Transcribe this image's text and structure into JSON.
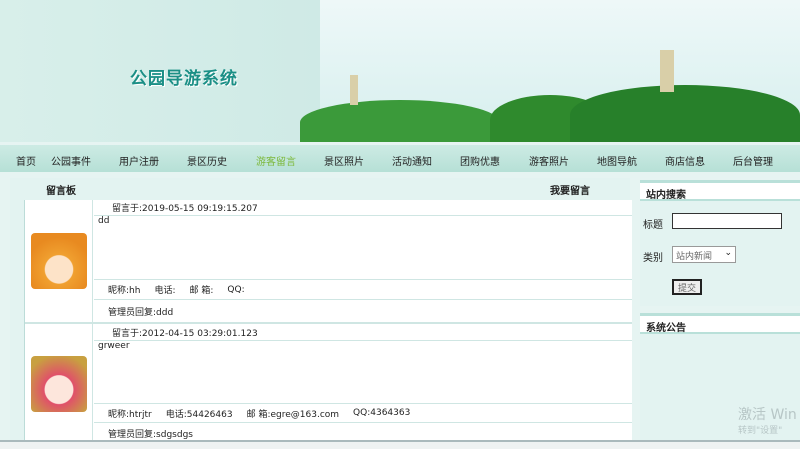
{
  "site_title": "公园导游系统",
  "nav": [
    "首页",
    "公园事件",
    "用户注册",
    "景区历史",
    "游客留言",
    "景区照片",
    "活动通知",
    "团购优惠",
    "游客照片",
    "地图导航",
    "商店信息",
    "后台管理"
  ],
  "nav_active": 4,
  "board": {
    "title": "留言板",
    "post_link": "我要留言"
  },
  "messages": [
    {
      "date_label": "留言于:",
      "date": "2019-05-15 09:19:15.207",
      "content": "dd",
      "nick_label": "昵称:",
      "nick": "hh",
      "phone_label": "电话:",
      "phone": "",
      "email_label": "邮 箱:",
      "email": "",
      "qq_label": "QQ:",
      "qq": "",
      "reply_label": "管理员回复:",
      "reply": "ddd"
    },
    {
      "date_label": "留言于:",
      "date": "2012-04-15 03:29:01.123",
      "content": "grweer",
      "nick_label": "昵称:",
      "nick": "htrjtr",
      "phone_label": "电话:",
      "phone": "54426463",
      "email_label": "邮 箱:",
      "email": "egre@163.com",
      "qq_label": "QQ:",
      "qq": "4364363",
      "reply_label": "管理员回复:",
      "reply": "sdgsdgs"
    }
  ],
  "search": {
    "title": "站内搜索",
    "title_label": "标题",
    "title_value": "",
    "category_label": "类别",
    "category_selected": "站内新闻",
    "submit": "提交"
  },
  "notice": {
    "title": "系统公告"
  },
  "watermark": {
    "line1": "激活 Win",
    "line2": "转到\"设置\""
  },
  "colors": {
    "accent": "#1b8f86",
    "nav_active": "#7cb83a"
  }
}
